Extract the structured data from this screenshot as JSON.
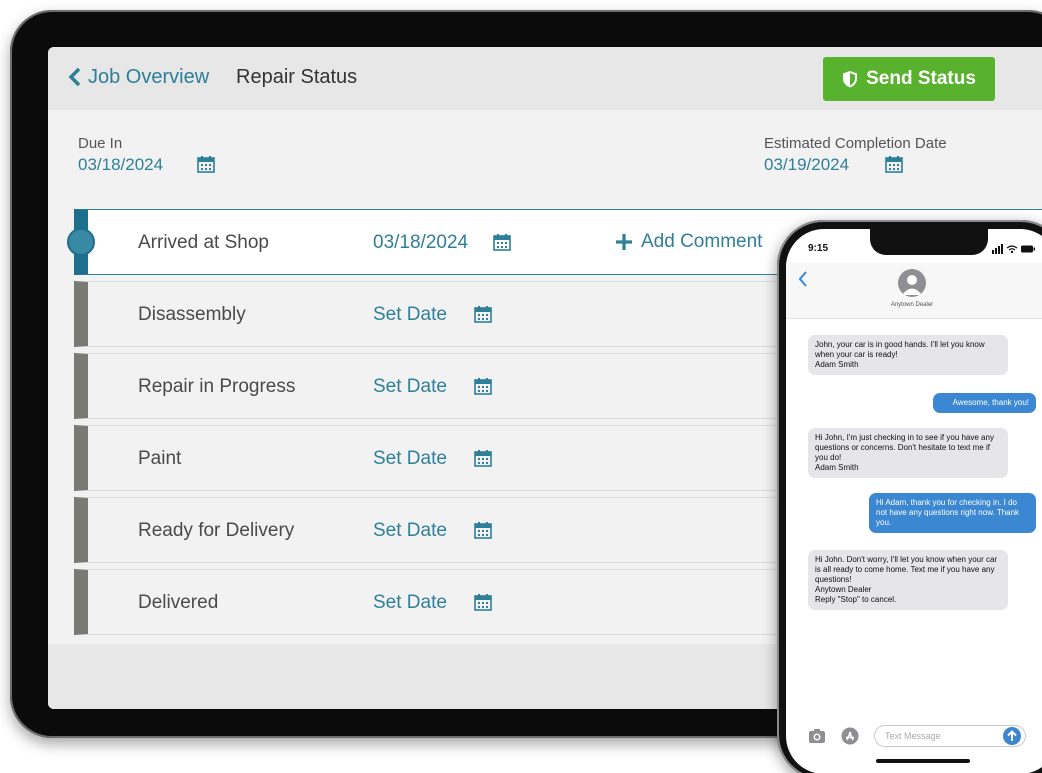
{
  "header": {
    "back_label": "Job Overview",
    "title": "Repair Status",
    "send_button": "Send Status"
  },
  "due_in": {
    "label": "Due In",
    "value": "03/18/2024"
  },
  "est_completion": {
    "label": "Estimated Completion Date",
    "value": "03/19/2024"
  },
  "steps": [
    {
      "name": "Arrived at Shop",
      "date": "03/18/2024",
      "active": true,
      "comment_label": "Add Comment"
    },
    {
      "name": "Disassembly",
      "date": "Set Date"
    },
    {
      "name": "Repair in Progress",
      "date": "Set Date"
    },
    {
      "name": "Paint",
      "date": "Set Date"
    },
    {
      "name": "Ready for Delivery",
      "date": "Set Date"
    },
    {
      "name": "Delivered",
      "date": "Set Date"
    }
  ],
  "phone": {
    "time": "9:15",
    "contact": "Anytown Dealer",
    "messages": [
      {
        "from": "dealer",
        "text": "John, your car is in good hands. I'll let you know when your car is ready!\nAdam Smith"
      },
      {
        "from": "user",
        "text": "Awesome, thank you!"
      },
      {
        "from": "dealer",
        "text": "Hi John, I'm just checking in to see if you have any questions or concerns. Don't hesitate to text me if you do!\nAdam Smith"
      },
      {
        "from": "user",
        "text": "Hi Adam, thank you for checking in. I do not have any questions right now. Thank you."
      },
      {
        "from": "dealer",
        "text": "Hi John. Don't worry, I'll let you know when your car is all ready to come home. Text me if you have any questions!\nAnytown Dealer\nReply \"Stop\" to cancel."
      }
    ],
    "input_placeholder": "Text Message"
  },
  "colors": {
    "accent": "#2e7f9a",
    "send_green": "#58b22d",
    "bubble_blue": "#3b87d2"
  }
}
